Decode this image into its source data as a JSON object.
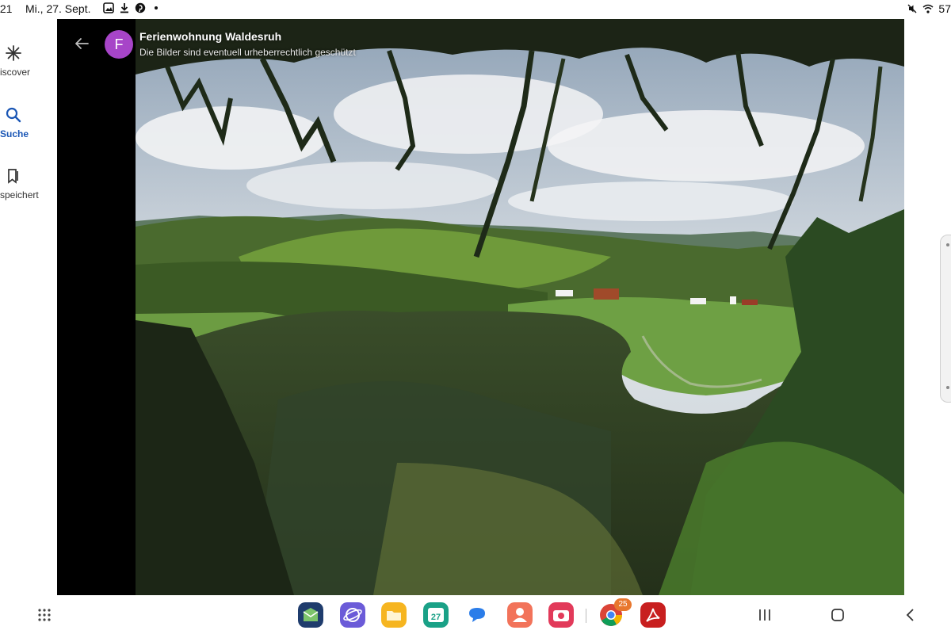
{
  "status_bar": {
    "time": ":21",
    "date": "Mi., 27. Sept.",
    "battery": "57"
  },
  "rail": {
    "items": [
      {
        "label": "iscover",
        "icon": "sparkle-icon",
        "active": false
      },
      {
        "label": "Suche",
        "icon": "search-icon",
        "active": true
      },
      {
        "label": "speichert",
        "icon": "bookmarks-icon",
        "active": false
      }
    ]
  },
  "viewer": {
    "avatar_letter": "F",
    "title": "Ferienwohnung Waldesruh",
    "subtitle": "Die Bilder sind eventuell urheberrechtlich geschützt"
  },
  "taskbar": {
    "calendar_day": "27",
    "chrome_badge": "25",
    "apps": [
      "mail-app-icon",
      "internet-app-icon",
      "files-app-icon",
      "calendar-app-icon",
      "messages-app-icon",
      "contacts-app-icon",
      "camera-app-icon",
      "chrome-app-icon",
      "pdf-app-icon"
    ]
  },
  "colors": {
    "accent": "#1a56b5",
    "avatar": "#a745c8",
    "badge": "#e8772e"
  }
}
